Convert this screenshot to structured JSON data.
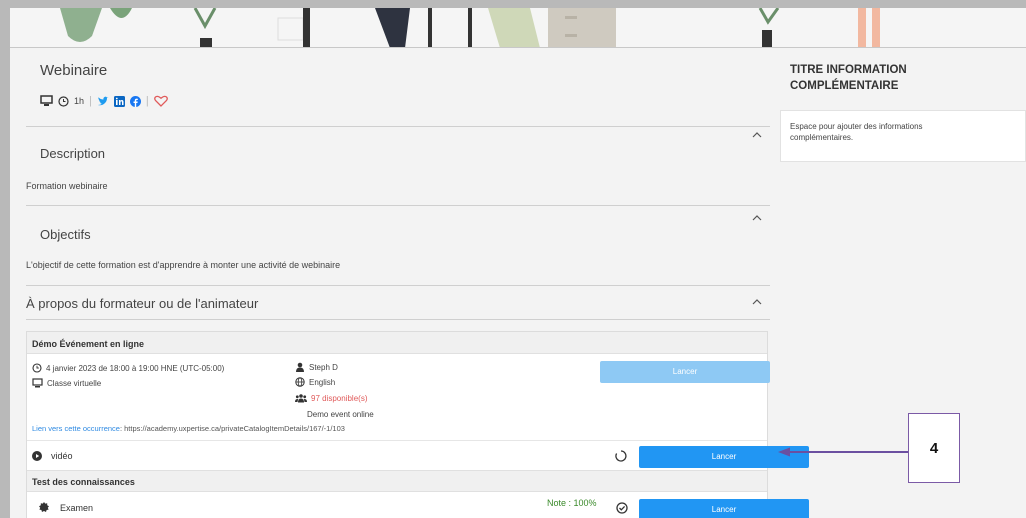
{
  "course": {
    "title": "Webinaire",
    "duration": "1h"
  },
  "sections": {
    "description": {
      "title": "Description",
      "body": "Formation webinaire"
    },
    "objectifs": {
      "title": "Objectifs",
      "body": "L'objectif de cette formation est d'apprendre à monter une activité de webinaire"
    },
    "about": {
      "title": "À propos du formateur ou de l'animateur"
    }
  },
  "event": {
    "header": "Démo Événement en ligne",
    "date": "4 janvier 2023 de 18:00 à 19:00 HNE (UTC-05:00)",
    "format": "Classe virtuelle",
    "trainer": "Steph D",
    "language": "English",
    "availability": "97 disponible(s)",
    "event_name": "Demo event online",
    "link_label": "Lien vers cette occurrence",
    "link_url": ": https://academy.uxpertise.ca/privateCatalogItemDetails/167/-1/103",
    "launch_label": "Lancer"
  },
  "video": {
    "label": "vidéo",
    "launch_label": "Lancer"
  },
  "knowledge": {
    "header": "Test des connaissances",
    "exam_label": "Examen",
    "score": "Note : 100%",
    "launch_label": "Lancer"
  },
  "sidebar": {
    "title": "TITRE INFORMATION COMPLÉMENTAIRE",
    "text": "Espace pour ajouter des informations complémentaires."
  },
  "callout": {
    "number": "4"
  },
  "icons": [
    "monitor-icon",
    "clock-icon",
    "twitter-icon",
    "linkedin-icon",
    "facebook-icon",
    "heart-icon",
    "chevron-up-icon",
    "person-icon",
    "globe-icon",
    "group-icon",
    "play-icon",
    "spinner-icon",
    "badge-icon",
    "check-circle-icon"
  ],
  "colors": {
    "accent": "#2196f3",
    "accent_disabled": "#8ec9f4",
    "availability": "#e05a5a",
    "score": "#3a8a2a",
    "callout_border": "#7b5aa6"
  }
}
